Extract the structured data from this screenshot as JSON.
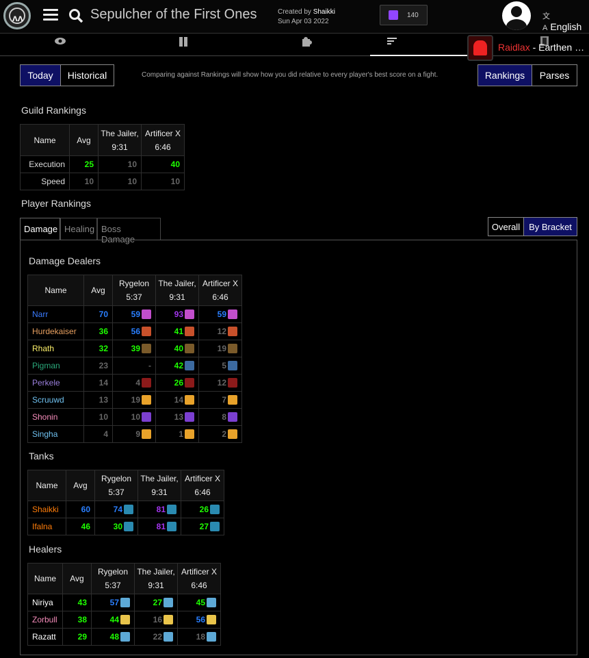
{
  "header": {
    "title": "Sepulcher of the First Ones",
    "created_by_prefix": "Created by",
    "author": "Shaikki",
    "date": "Sun Apr 03 2022",
    "twitch_count": "140",
    "language": "English"
  },
  "tabs": [
    "eye-icon",
    "damage-taken-icon",
    "puzzle-icon",
    "rankings-icon",
    "film-icon"
  ],
  "guild": {
    "name": "Raidlax",
    "realm": " - Earthen …"
  },
  "view": {
    "today": "Today",
    "historical": "Historical",
    "note": "Comparing against Rankings will show how you did relative to every player's best score on a fight.",
    "rankings": "Rankings",
    "parses": "Parses"
  },
  "guild_rankings": {
    "heading": "Guild Rankings",
    "headers": [
      "Name",
      "Avg",
      "The Jailer,",
      "9:31",
      "Artificer X",
      "6:46"
    ],
    "rows": [
      {
        "name": "Execution",
        "avg": "25",
        "avg_color": "green",
        "vals": [
          {
            "v": "10",
            "c": "gray"
          },
          {
            "v": "40",
            "c": "green"
          }
        ]
      },
      {
        "name": "Speed",
        "avg": "10",
        "avg_color": "gray",
        "vals": [
          {
            "v": "10",
            "c": "gray"
          },
          {
            "v": "10",
            "c": "gray"
          }
        ]
      }
    ]
  },
  "player_rankings": {
    "heading": "Player Rankings",
    "tabs": [
      "Damage",
      "Healing",
      "Boss Damage"
    ],
    "overall": "Overall",
    "by_bracket": "By Bracket"
  },
  "boss_headers": [
    [
      "Rygelon",
      "5:37"
    ],
    [
      "The Jailer,",
      "9:31"
    ],
    [
      "Artificer X",
      "6:46"
    ]
  ],
  "dps": {
    "heading": "Damage Dealers",
    "rows": [
      {
        "name": "Narr",
        "color": "#3b7cff",
        "avg": "70",
        "avg_c": "blue",
        "cells": [
          [
            "59",
            "blue",
            "mage"
          ],
          [
            "93",
            "purple",
            "mage"
          ],
          [
            "59",
            "blue",
            "mage"
          ]
        ]
      },
      {
        "name": "Hurdekaiser",
        "color": "#e8a060",
        "avg": "36",
        "avg_c": "green",
        "cells": [
          [
            "56",
            "blue",
            "fire"
          ],
          [
            "41",
            "green",
            "fire"
          ],
          [
            "12",
            "gray",
            "fire"
          ]
        ]
      },
      {
        "name": "Rhath",
        "color": "#fff26b",
        "avg": "32",
        "avg_c": "green",
        "cells": [
          [
            "39",
            "green",
            "arrow"
          ],
          [
            "40",
            "green",
            "arrow"
          ],
          [
            "19",
            "gray",
            "arrow"
          ]
        ]
      },
      {
        "name": "Pigman",
        "color": "#2aa87a",
        "avg": "23",
        "avg_c": "gray",
        "cells": [
          [
            "-",
            "gray",
            ""
          ],
          [
            "42",
            "green",
            "gear"
          ],
          [
            "5",
            "gray",
            "gear"
          ]
        ]
      },
      {
        "name": "Perkele",
        "color": "#9a7fdc",
        "avg": "14",
        "avg_c": "gray",
        "cells": [
          [
            "4",
            "gray",
            "dk"
          ],
          [
            "26",
            "green",
            "dk"
          ],
          [
            "12",
            "gray",
            "dk"
          ]
        ]
      },
      {
        "name": "Scruuwd",
        "color": "#6fc0ef",
        "avg": "13",
        "avg_c": "gray",
        "cells": [
          [
            "19",
            "gray",
            "flame"
          ],
          [
            "14",
            "gray",
            "flame"
          ],
          [
            "7",
            "gray",
            "flame"
          ]
        ]
      },
      {
        "name": "Shonin",
        "color": "#f58cba",
        "avg": "10",
        "avg_c": "gray",
        "cells": [
          [
            "10",
            "gray",
            "void"
          ],
          [
            "13",
            "gray",
            "void"
          ],
          [
            "8",
            "gray",
            "void"
          ]
        ]
      },
      {
        "name": "Singha",
        "color": "#6fc0ef",
        "avg": "4",
        "avg_c": "gray",
        "cells": [
          [
            "9",
            "gray",
            "flame"
          ],
          [
            "1",
            "gray",
            "flame"
          ],
          [
            "2",
            "gray",
            "flame"
          ]
        ]
      }
    ]
  },
  "tanks": {
    "heading": "Tanks",
    "rows": [
      {
        "name": "Shaikki",
        "color": "#ff7d0a",
        "avg": "60",
        "avg_c": "blue",
        "cells": [
          [
            "74",
            "blue",
            "shield"
          ],
          [
            "81",
            "purple",
            "shield"
          ],
          [
            "26",
            "green",
            "shield"
          ]
        ]
      },
      {
        "name": "Ifalna",
        "color": "#ff7d0a",
        "avg": "46",
        "avg_c": "green",
        "cells": [
          [
            "30",
            "green",
            "shield"
          ],
          [
            "81",
            "purple",
            "shield"
          ],
          [
            "27",
            "green",
            "shield"
          ]
        ]
      }
    ]
  },
  "healers": {
    "heading": "Healers",
    "rows": [
      {
        "name": "Niriya",
        "color": "#ffffff",
        "avg": "43",
        "avg_c": "green",
        "cells": [
          [
            "57",
            "blue",
            "disc"
          ],
          [
            "27",
            "green",
            "disc"
          ],
          [
            "45",
            "green",
            "disc"
          ]
        ]
      },
      {
        "name": "Zorbull",
        "color": "#f58cba",
        "avg": "38",
        "avg_c": "green",
        "cells": [
          [
            "44",
            "green",
            "holy"
          ],
          [
            "16",
            "gray",
            "holy"
          ],
          [
            "56",
            "blue",
            "holy"
          ]
        ]
      },
      {
        "name": "Razatt",
        "color": "#ffffff",
        "avg": "29",
        "avg_c": "green",
        "cells": [
          [
            "48",
            "green",
            "disc"
          ],
          [
            "22",
            "gray",
            "disc"
          ],
          [
            "18",
            "gray",
            "disc"
          ]
        ]
      }
    ]
  }
}
